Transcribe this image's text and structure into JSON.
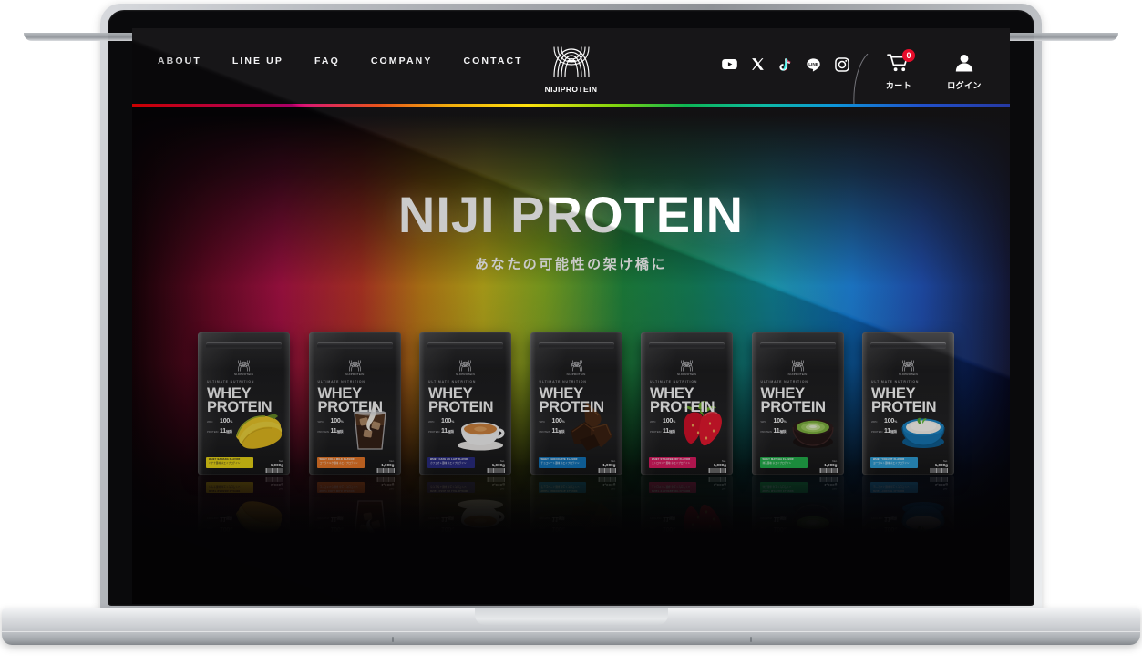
{
  "site": {
    "brand": "NIJIPROTEIN",
    "accent_rainbow": [
      "#ff0000",
      "#d5007e",
      "#f0a800",
      "#ffe000",
      "#00b24a",
      "#0090d8",
      "#1b2f9e"
    ]
  },
  "header": {
    "nav": [
      {
        "label": "ABOUT"
      },
      {
        "label": "LINE UP"
      },
      {
        "label": "FAQ"
      },
      {
        "label": "COMPANY"
      },
      {
        "label": "CONTACT"
      }
    ],
    "logo": {
      "text": "NIJIPROTEIN",
      "icon": "niji-bridge-logo-icon"
    },
    "social": [
      {
        "name": "youtube-icon",
        "label": "YouTube"
      },
      {
        "name": "x-twitter-icon",
        "label": "X"
      },
      {
        "name": "tiktok-icon",
        "label": "TikTok"
      },
      {
        "name": "line-icon",
        "label": "LINE"
      },
      {
        "name": "instagram-icon",
        "label": "Instagram"
      }
    ],
    "cart": {
      "label": "カート",
      "count": "0",
      "icon": "shopping-cart-icon",
      "badge_color": "#e60020"
    },
    "login": {
      "label": "ログイン",
      "icon": "user-person-icon"
    }
  },
  "hero": {
    "title": "NIJI PROTEIN",
    "subtitle": "あなたの可能性の架け橋に"
  },
  "products": [
    {
      "flavor": "banana",
      "kicker": "ULTIMATE NUTRITION",
      "title_line1": "WHEY",
      "title_line2": "PROTEIN",
      "strip_line1": "WHEY BANANA FLAVOR",
      "strip_line2": "バナナ風味 ホエイプロテイン",
      "strip_color": "#f2dd16",
      "strip_text_dark": true,
      "weight_label": "Net.",
      "weight_value": "1,000g",
      "specs": [
        {
          "label": "WPC",
          "value": "100",
          "unit": "%"
        },
        {
          "label": "PROTEIN",
          "value": "11",
          "unit": "種類"
        }
      ],
      "art": "banana-bunch-image"
    },
    {
      "flavor": "cola",
      "kicker": "ULTIMATE NUTRITION",
      "title_line1": "WHEY",
      "title_line2": "PROTEIN",
      "strip_line1": "WHEY COLA MILK FLAVOR",
      "strip_line2": "コーラミルク風味 ホエイプロテイン",
      "strip_color": "#ef7b28",
      "strip_text_dark": false,
      "weight_label": "Net.",
      "weight_value": "1,000g",
      "specs": [
        {
          "label": "WPC",
          "value": "100",
          "unit": "%"
        },
        {
          "label": "PROTEIN",
          "value": "11",
          "unit": "種類"
        }
      ],
      "art": "cola-glass-image"
    },
    {
      "flavor": "cafe-au-lait",
      "kicker": "ULTIMATE NUTRITION",
      "title_line1": "WHEY",
      "title_line2": "PROTEIN",
      "strip_line1": "WHEY CAFE AU LAIT FLAVOR",
      "strip_line2": "カフェオレ風味 ホエイプロテイン",
      "strip_color": "#2a2c82",
      "strip_text_dark": false,
      "weight_label": "Net.",
      "weight_value": "1,000g",
      "specs": [
        {
          "label": "WPC",
          "value": "100",
          "unit": "%"
        },
        {
          "label": "PROTEIN",
          "value": "11",
          "unit": "種類"
        }
      ],
      "art": "coffee-cup-image"
    },
    {
      "flavor": "chocolate",
      "kicker": "ULTIMATE NUTRITION",
      "title_line1": "WHEY",
      "title_line2": "PROTEIN",
      "strip_line1": "WHEY CHOCOLATE FLAVOR",
      "strip_line2": "チョコレート風味 ホエイプロテイン",
      "strip_color": "#1276bd",
      "strip_text_dark": false,
      "weight_label": "Net.",
      "weight_value": "1,000g",
      "specs": [
        {
          "label": "WPC",
          "value": "100",
          "unit": "%"
        },
        {
          "label": "PROTEIN",
          "value": "11",
          "unit": "種類"
        }
      ],
      "art": "chocolate-chunks-image"
    },
    {
      "flavor": "strawberry",
      "kicker": "ULTIMATE NUTRITION",
      "title_line1": "WHEY",
      "title_line2": "PROTEIN",
      "strip_line1": "WHEY STRAWBERRY FLAVOR",
      "strip_line2": "ストロベリー風味 ホエイプロテイン",
      "strip_color": "#e01b63",
      "strip_text_dark": false,
      "weight_label": "Net.",
      "weight_value": "1,000g",
      "specs": [
        {
          "label": "WPC",
          "value": "100",
          "unit": "%"
        },
        {
          "label": "PROTEIN",
          "value": "11",
          "unit": "種類"
        }
      ],
      "art": "strawberry-image"
    },
    {
      "flavor": "matcha",
      "kicker": "ULTIMATE NUTRITION",
      "title_line1": "WHEY",
      "title_line2": "PROTEIN",
      "strip_line1": "WHEY MATCHA FLAVOR",
      "strip_line2": "抹茶風味 ホエイプロテイン",
      "strip_color": "#22b14c",
      "strip_text_dark": false,
      "weight_label": "Net.",
      "weight_value": "1,000g",
      "specs": [
        {
          "label": "WPC",
          "value": "100",
          "unit": "%"
        },
        {
          "label": "PROTEIN",
          "value": "11",
          "unit": "種類"
        }
      ],
      "art": "matcha-bowl-image"
    },
    {
      "flavor": "yogurt",
      "kicker": "ULTIMATE NUTRITION",
      "title_line1": "WHEY",
      "title_line2": "PROTEIN",
      "strip_line1": "WHEY YOGURT FLAVOR",
      "strip_line2": "ヨーグルト風味 ホエイプロテイン",
      "strip_color": "#2e9ed6",
      "strip_text_dark": false,
      "weight_label": "Net.",
      "weight_value": "1,000g",
      "specs": [
        {
          "label": "WPC",
          "value": "100",
          "unit": "%"
        },
        {
          "label": "PROTEIN",
          "value": "11",
          "unit": "種類"
        }
      ],
      "art": "yogurt-bowl-image"
    }
  ]
}
